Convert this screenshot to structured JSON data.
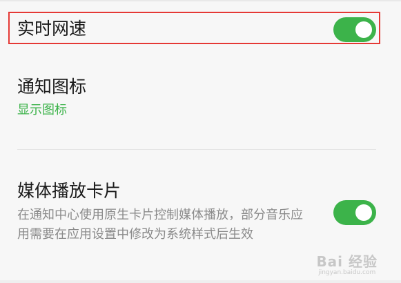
{
  "settings": {
    "realtime_speed": {
      "label": "实时网速",
      "enabled": true
    },
    "notification_icon": {
      "label": "通知图标",
      "value": "显示图标"
    },
    "media_card": {
      "label": "媒体播放卡片",
      "description": "在通知中心使用原生卡片控制媒体播放，部分音乐应用需要在应用设置中修改为系统样式后生效",
      "enabled": true
    }
  },
  "watermark": {
    "brand": "Bai 经验",
    "url": "jingyan.baidu.com"
  },
  "colors": {
    "toggle_on": "#3cb34a",
    "accent_text": "#3cb34a",
    "highlight_border": "#e53935"
  }
}
